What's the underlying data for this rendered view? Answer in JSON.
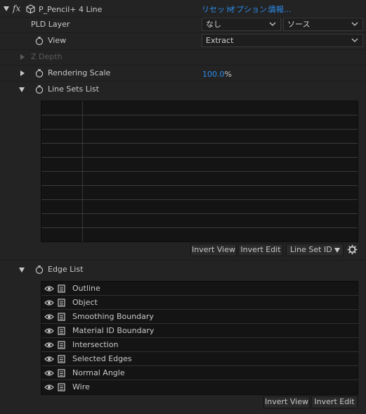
{
  "effect": {
    "fx_symbol": "fx",
    "name": "P_Pencil+ 4 Line",
    "links": {
      "reset": "リセット",
      "options": "オプション...",
      "info": "情報..."
    }
  },
  "pld_layer": {
    "label": "PLD Layer",
    "layer_value": "なし",
    "source_value": "ソース"
  },
  "view": {
    "label": "View",
    "value": "Extract"
  },
  "z_depth": {
    "label": "Z Depth"
  },
  "rendering_scale": {
    "label": "Rendering Scale",
    "value": "100.0",
    "unit": "%"
  },
  "line_sets": {
    "label": "Line Sets List",
    "rows": [
      "",
      "",
      "",
      "",
      "",
      "",
      "",
      "",
      "",
      ""
    ],
    "buttons": {
      "invert_view": "Invert View",
      "invert_edit": "Invert Edit",
      "line_set_id": "Line Set ID"
    }
  },
  "edge_list": {
    "label": "Edge List",
    "items": [
      "Outline",
      "Object",
      "Smoothing Boundary",
      "Material ID Boundary",
      "Intersection",
      "Selected Edges",
      "Normal Angle",
      "Wire"
    ],
    "buttons": {
      "invert_view": "Invert View",
      "invert_edit": "Invert Edit"
    }
  },
  "icons": {
    "twirl_open": "triangle-down-icon",
    "twirl_closed": "triangle-right-icon",
    "stopwatch": "stopwatch-icon",
    "cube": "cube-icon",
    "eye": "eye-icon",
    "edge_doc": "document-icon",
    "gear": "gear-icon",
    "dropdown": "chevron-down-icon"
  },
  "colors": {
    "background": "#232323",
    "link": "#2d8ceb",
    "table": "#141414",
    "text": "#c8c8c8"
  }
}
